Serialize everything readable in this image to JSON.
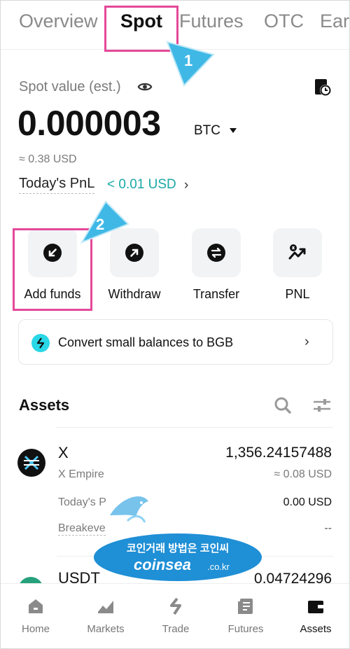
{
  "tabs": [
    {
      "label": "Overview",
      "active": false
    },
    {
      "label": "Spot",
      "active": true
    },
    {
      "label": "Futures",
      "active": false
    },
    {
      "label": "OTC",
      "active": false
    },
    {
      "label": "Ear",
      "active": false
    }
  ],
  "callouts": {
    "step1": "1",
    "step2": "2"
  },
  "spot": {
    "label": "Spot value (est.)",
    "value": "0.000003",
    "unit": "BTC",
    "approx_usd": "≈ 0.38 USD",
    "pnl_label": "Today's PnL",
    "pnl_value": "< 0.01 USD"
  },
  "actions": [
    {
      "label": "Add funds",
      "icon": "add-funds-icon"
    },
    {
      "label": "Withdraw",
      "icon": "withdraw-icon"
    },
    {
      "label": "Transfer",
      "icon": "transfer-icon"
    },
    {
      "label": "PNL",
      "icon": "pnl-icon"
    }
  ],
  "convert_banner": {
    "text": "Convert small balances to BGB"
  },
  "assets": {
    "title": "Assets",
    "items": [
      {
        "symbol": "X",
        "name": "X Empire",
        "amount": "1,356.24157488",
        "usd": "≈ 0.08 USD",
        "pnl_label": "Today's P",
        "pnl_value": "0.00 USD",
        "breakeven_label": "Breakeve",
        "breakeven_value": "--"
      },
      {
        "symbol": "USDT",
        "amount": "0.04724296"
      }
    ]
  },
  "watermark": {
    "korean": "코인거래 방법은 코인씨",
    "site": "coinsea",
    "domain": ".co.kr"
  },
  "bottom_nav": [
    {
      "label": "Home",
      "active": false
    },
    {
      "label": "Markets",
      "active": false
    },
    {
      "label": "Trade",
      "active": false
    },
    {
      "label": "Futures",
      "active": false
    },
    {
      "label": "Assets",
      "active": true
    }
  ],
  "colors": {
    "accent_teal": "#1aa7a7",
    "highlight": "#e4489a",
    "callout_blue": "#3fb8e6"
  }
}
